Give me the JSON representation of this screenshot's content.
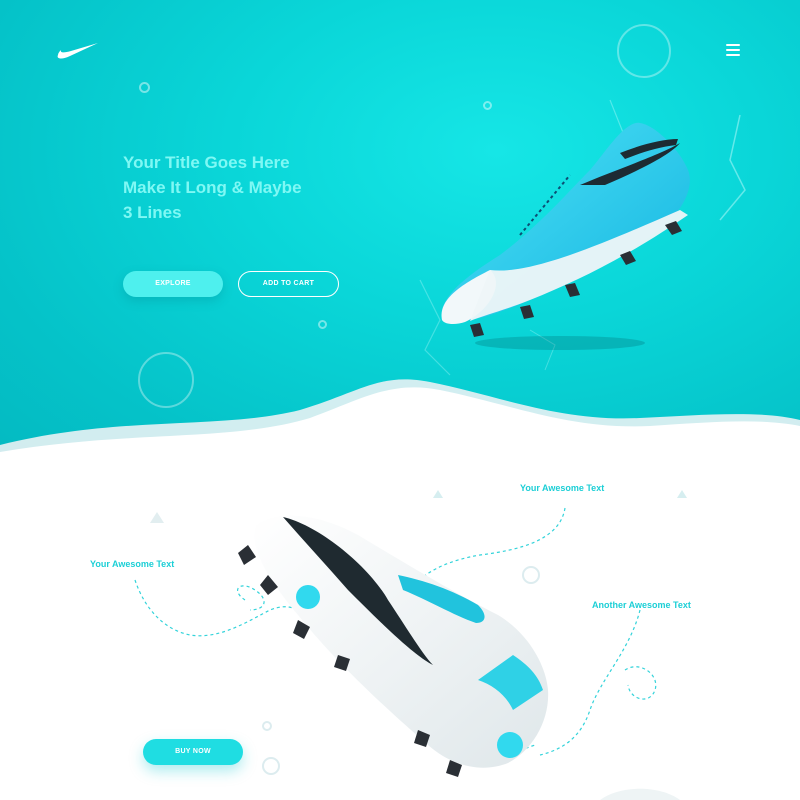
{
  "hero": {
    "title_lines": [
      "Your Title Goes Here",
      "Make It Long & Maybe",
      "3 Lines"
    ],
    "explore_label": "EXPLORE",
    "cart_label": "ADD TO CART"
  },
  "features": {
    "label_1": "Your Awesome Text",
    "label_2": "Your Awesome Text",
    "label_3": "Another Awesome Text"
  },
  "cta": {
    "buy_label": "BUY NOW"
  },
  "colors": {
    "hero_teal": "#05c3c9",
    "accent_cyan": "#1fdde2",
    "title_tint": "#7ff8f4",
    "label_cyan": "#1ccfd6"
  },
  "icons": {
    "logo": "swoosh-logo-icon",
    "menu": "hamburger-menu-icon"
  }
}
